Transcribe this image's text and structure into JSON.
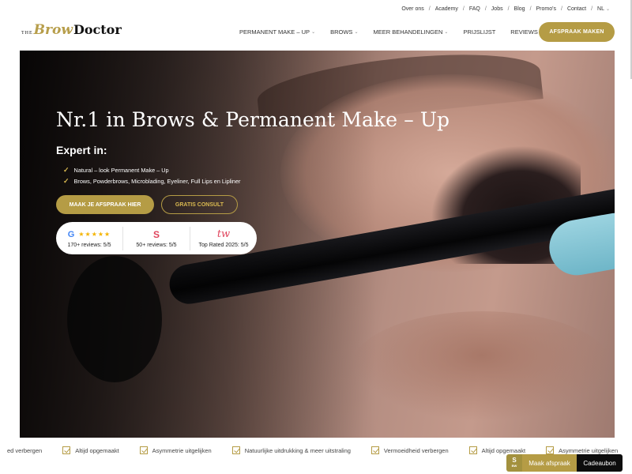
{
  "topbar": {
    "links": [
      "Over ons",
      "Academy",
      "FAQ",
      "Jobs",
      "Blog",
      "Promo's",
      "Contact",
      "NL"
    ]
  },
  "logo": {
    "the": "THE",
    "brow": "Brow",
    "doctor": "Doctor"
  },
  "nav": {
    "items": [
      {
        "label": "PERMANENT MAKE – UP",
        "dropdown": true
      },
      {
        "label": "BROWS",
        "dropdown": true
      },
      {
        "label": "MEER BEHANDELINGEN",
        "dropdown": true
      },
      {
        "label": "PRIJSLIJST",
        "dropdown": false
      },
      {
        "label": "REVIEWS",
        "dropdown": false
      }
    ],
    "cta": "AFSPRAAK MAKEN"
  },
  "hero": {
    "title": "Nr.1 in Brows & Permanent Make – Up",
    "expert": "Expert in:",
    "bullets": [
      "Natural – look Permanent Make – Up",
      "Brows, Powderbrows, Microblading, Eyeliner, Full Lips en Lipliner"
    ],
    "primary_button": "MAAK JE AFSPRAAK HIER",
    "secondary_button": "GRATIS CONSULT",
    "reviews": [
      {
        "logo": "G",
        "stars": "★★★★★",
        "text": "170+ reviews: 5/5"
      },
      {
        "logo": "S",
        "text": "50+ reviews: 5/5"
      },
      {
        "logo": "tw",
        "text": "Top Rated 2025: 5/5"
      }
    ]
  },
  "features": [
    "ed verbergen",
    "Altijd opgemaakt",
    "Asymmetrie uitgelijken",
    "Natuurlijke uitdrukking & meer uitstraling",
    "Vermoeidheid verbergen",
    "Altijd opgemaakt",
    "Asymmetrie uitgelijken"
  ],
  "widget": {
    "mark": "S",
    "mark_sub": "BW",
    "maak": "Maak afspraak",
    "gift": "Cadeaubon"
  },
  "colors": {
    "gold": "#b59c45",
    "dark": "#0d0d0d"
  }
}
